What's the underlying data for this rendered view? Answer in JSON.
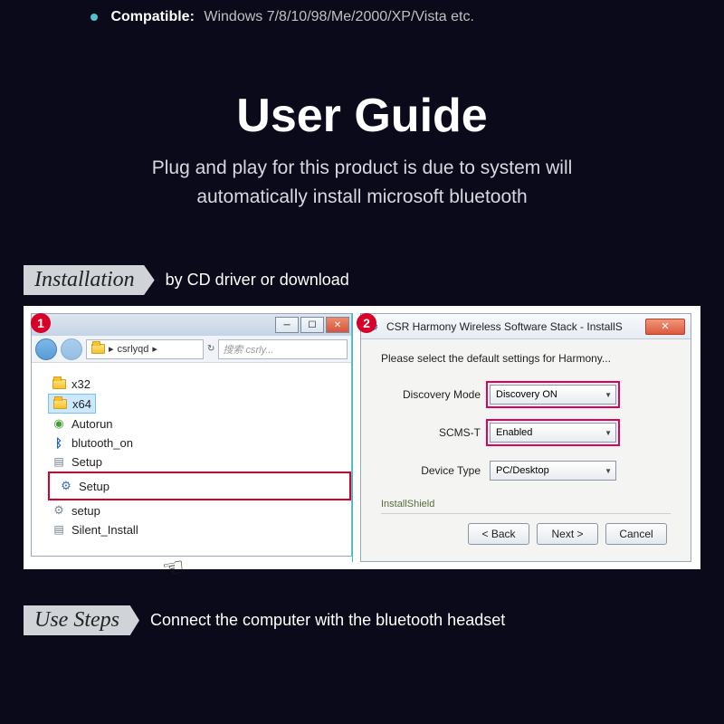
{
  "compat": {
    "label": "Compatible:",
    "text": "Windows 7/8/10/98/Me/2000/XP/Vista etc."
  },
  "title": "User Guide",
  "subtitle": "Plug and play for this product is due to system will automatically install microsoft bluetooth",
  "install": {
    "tag": "Installation",
    "sub": "by CD driver or download"
  },
  "panel1": {
    "badge": "1",
    "path_folder": "csrlyqd",
    "search_placeholder": "搜索 csrly...",
    "files": [
      "x32",
      "x64",
      "Autorun",
      "blutooth_on",
      "Setup",
      "Setup",
      "setup",
      "Silent_Install"
    ],
    "selected_index": 1,
    "highlight_index": 5
  },
  "panel2": {
    "badge": "2",
    "title": "CSR Harmony Wireless Software Stack - InstallS",
    "message": "Please select the default settings for Harmony...",
    "rows": [
      {
        "label": "Discovery Mode",
        "value": "Discovery ON",
        "hi": true
      },
      {
        "label": "SCMS-T",
        "value": "Enabled",
        "hi": true
      },
      {
        "label": "Device Type",
        "value": "PC/Desktop",
        "hi": false
      }
    ],
    "fieldset": "InstallShield",
    "buttons": {
      "back": "< Back",
      "next": "Next >",
      "cancel": "Cancel"
    }
  },
  "usesteps": {
    "tag": "Use Steps",
    "sub": "Connect the computer with the bluetooth headset"
  }
}
